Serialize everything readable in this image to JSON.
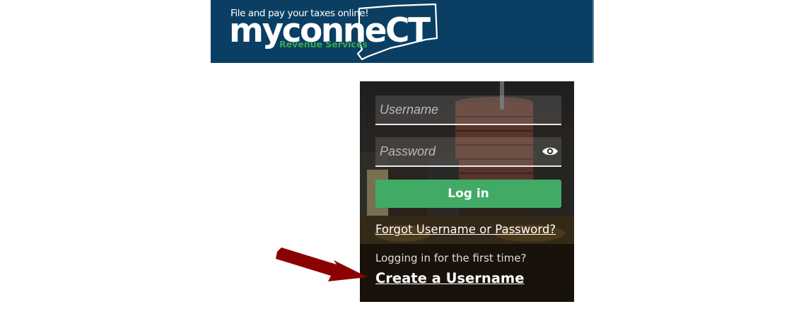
{
  "banner": {
    "tagline": "File and pay your taxes online!",
    "brand": "myconneCT",
    "subbrand": "Revenue Services"
  },
  "login": {
    "username_placeholder": "Username",
    "password_placeholder": "Password",
    "login_label": "Log in",
    "forgot_label": "Forgot Username or Password?",
    "first_time_text": "Logging in for the first time?",
    "create_label": "Create a Username"
  },
  "colors": {
    "banner_bg": "#0a3f63",
    "accent_green": "#41ab66",
    "arrow": "#8b0000"
  },
  "icons": [
    "connecticut-state-icon",
    "eye-icon",
    "arrow-icon"
  ]
}
